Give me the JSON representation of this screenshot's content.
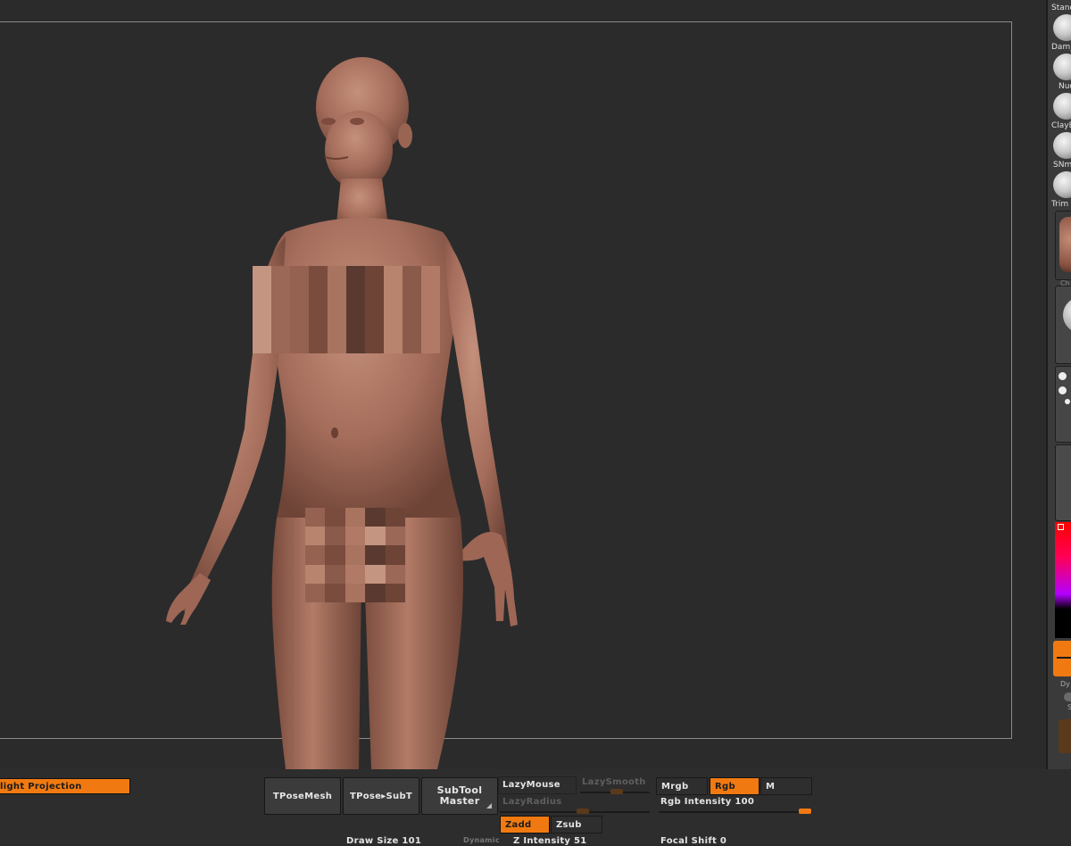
{
  "viewport": {
    "description_hidden": "",
    "model_skin_color": "#a86e5c"
  },
  "right_shelf": {
    "brushes": [
      {
        "label": "Stand",
        "icon": "standard-brush-icon"
      },
      {
        "label": "Dam_",
        "icon": "dam-standard-brush-icon"
      },
      {
        "label": "Nud",
        "icon": "move-brush-icon"
      },
      {
        "label": "ClayB",
        "icon": "clay-buildup-brush-icon"
      },
      {
        "label": "SNmo",
        "icon": "snake-hook-brush-icon"
      },
      {
        "label": "Trim",
        "icon": "trim-dynamic-brush-icon"
      }
    ],
    "material_label": "Ch",
    "color_label_top": "Dy",
    "color_label_bottom": "S",
    "color_hex": "#ff0000"
  },
  "bottom_bar": {
    "spotlight_projection": "light  Projection",
    "tpose_mesh": "TPoseMesh",
    "tpose_subt": "TPose▸SubT",
    "subtool_master_line1": "SubTool",
    "subtool_master_line2": "Master",
    "lazy_mouse": "LazyMouse",
    "lazy_smooth": "LazySmooth",
    "lazy_radius": "LazyRadius",
    "mrgb": "Mrgb",
    "rgb": "Rgb",
    "m": "M",
    "rgb_intensity": "Rgb  Intensity  100",
    "zadd": "Zadd",
    "zsub": "Zsub",
    "draw_size": "Draw  Size  101",
    "dynamic": "Dynamic",
    "z_intensity": "Z  Intensity  51",
    "focal_shift": "Focal  Shift  0"
  },
  "colors": {
    "accent": "#f07a11",
    "background": "#2a2a2a",
    "button": "#3b3b3b"
  }
}
